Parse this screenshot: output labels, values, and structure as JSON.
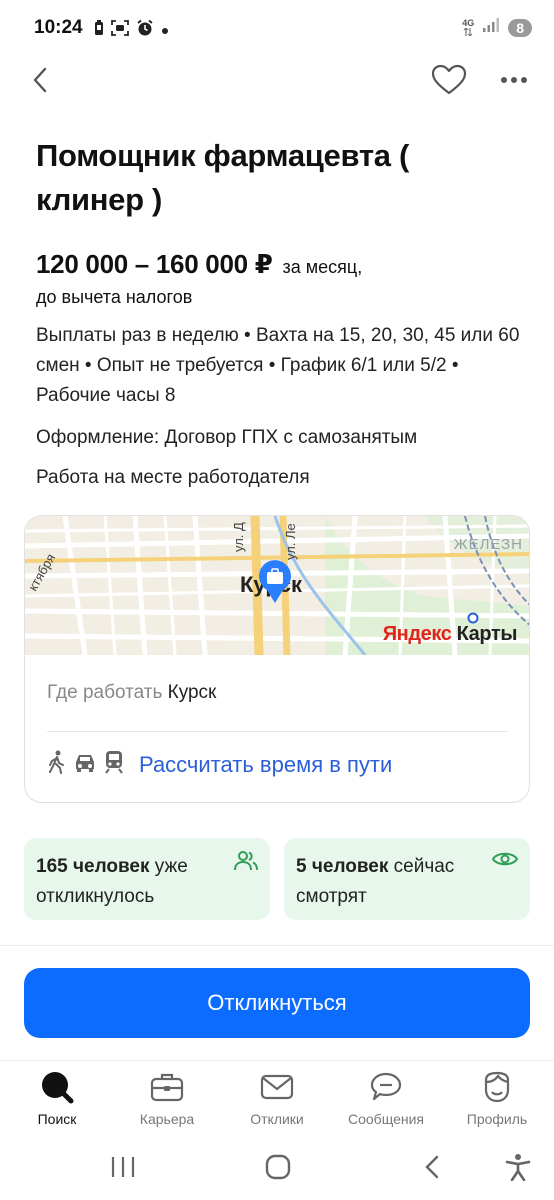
{
  "status_bar": {
    "time": "10:24",
    "network": "4G",
    "notifications_count": "8"
  },
  "vacancy": {
    "title": "Помощник фармацевта ( клинер )",
    "salary_range": "120 000 – 160 000 ₽",
    "salary_period": "за месяц,",
    "salary_tax_note": "до вычета налогов",
    "conditions": "Выплаты раз в неделю • Вахта на 15, 20, 30, 45 или 60 смен • Опыт не требуется • График 6/1 или 5/2 • Рабочие часы 8",
    "registration": "Оформление: Договор ГПХ с самозанятым",
    "workplace": "Работа на месте работодателя"
  },
  "map": {
    "city_label": "Курск",
    "brand_ya": "Яндекс",
    "brand_maps": " Карты",
    "street_labels": [
      "ул. Д",
      "ул. Ле",
      "ктября"
    ],
    "rail_label": "ЖЕЛЕЗН",
    "where_label": "Где работать",
    "where_value": "Курск",
    "route_link": "Рассчитать время в пути",
    "transport_icons": [
      "walking-icon",
      "car-icon",
      "train-icon"
    ]
  },
  "stats": {
    "responded_count": "165 человек",
    "responded_rest": "уже откликнулось",
    "viewing_count": "5 человек",
    "viewing_rest": "сейчас смотрят"
  },
  "actions": {
    "respond_button": "Откликнуться"
  },
  "bottom_nav": {
    "search": "Поиск",
    "career": "Карьера",
    "responses": "Отклики",
    "messages": "Сообщения",
    "profile": "Профиль",
    "active": "search"
  },
  "colors": {
    "accent_blue": "#0b6cff",
    "link_blue": "#2a5fd9",
    "stat_bg": "#e8f7ec",
    "stat_icon_green": "#2e9e57"
  }
}
